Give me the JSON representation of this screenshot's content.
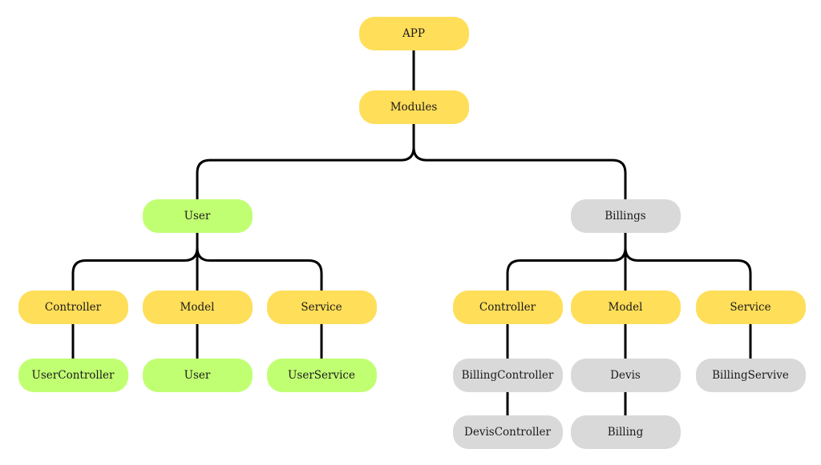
{
  "colors": {
    "yellow": "#FFDE59",
    "green": "#C1FF72",
    "gray": "#D9D9D9",
    "line": "#000000"
  },
  "nodes": [
    {
      "id": "app",
      "label": "APP",
      "color": "yellow",
      "parent": null
    },
    {
      "id": "modules",
      "label": "Modules",
      "color": "yellow",
      "parent": "app"
    },
    {
      "id": "user",
      "label": "User",
      "color": "green",
      "parent": "modules"
    },
    {
      "id": "billings",
      "label": "Billings",
      "color": "gray",
      "parent": "modules"
    },
    {
      "id": "user-controller",
      "label": "Controller",
      "color": "yellow",
      "parent": "user"
    },
    {
      "id": "user-model",
      "label": "Model",
      "color": "yellow",
      "parent": "user"
    },
    {
      "id": "user-service",
      "label": "Service",
      "color": "yellow",
      "parent": "user"
    },
    {
      "id": "usercontroller",
      "label": "UserController",
      "color": "green",
      "parent": "user-controller"
    },
    {
      "id": "user-entity",
      "label": "User",
      "color": "green",
      "parent": "user-model"
    },
    {
      "id": "userservice",
      "label": "UserService",
      "color": "green",
      "parent": "user-service"
    },
    {
      "id": "billing-controller",
      "label": "Controller",
      "color": "yellow",
      "parent": "billings"
    },
    {
      "id": "billing-model",
      "label": "Model",
      "color": "yellow",
      "parent": "billings"
    },
    {
      "id": "billing-service",
      "label": "Service",
      "color": "yellow",
      "parent": "billings"
    },
    {
      "id": "billingcontroller",
      "label": "BillingController",
      "color": "gray",
      "parent": "billing-controller"
    },
    {
      "id": "deviscontroller",
      "label": "DevisController",
      "color": "gray",
      "parent": "billingcontroller"
    },
    {
      "id": "devis",
      "label": "Devis",
      "color": "gray",
      "parent": "billing-model"
    },
    {
      "id": "billing",
      "label": "Billing",
      "color": "gray",
      "parent": "devis"
    },
    {
      "id": "billingservive",
      "label": "BillingServive",
      "color": "gray",
      "parent": "billing-service"
    }
  ]
}
